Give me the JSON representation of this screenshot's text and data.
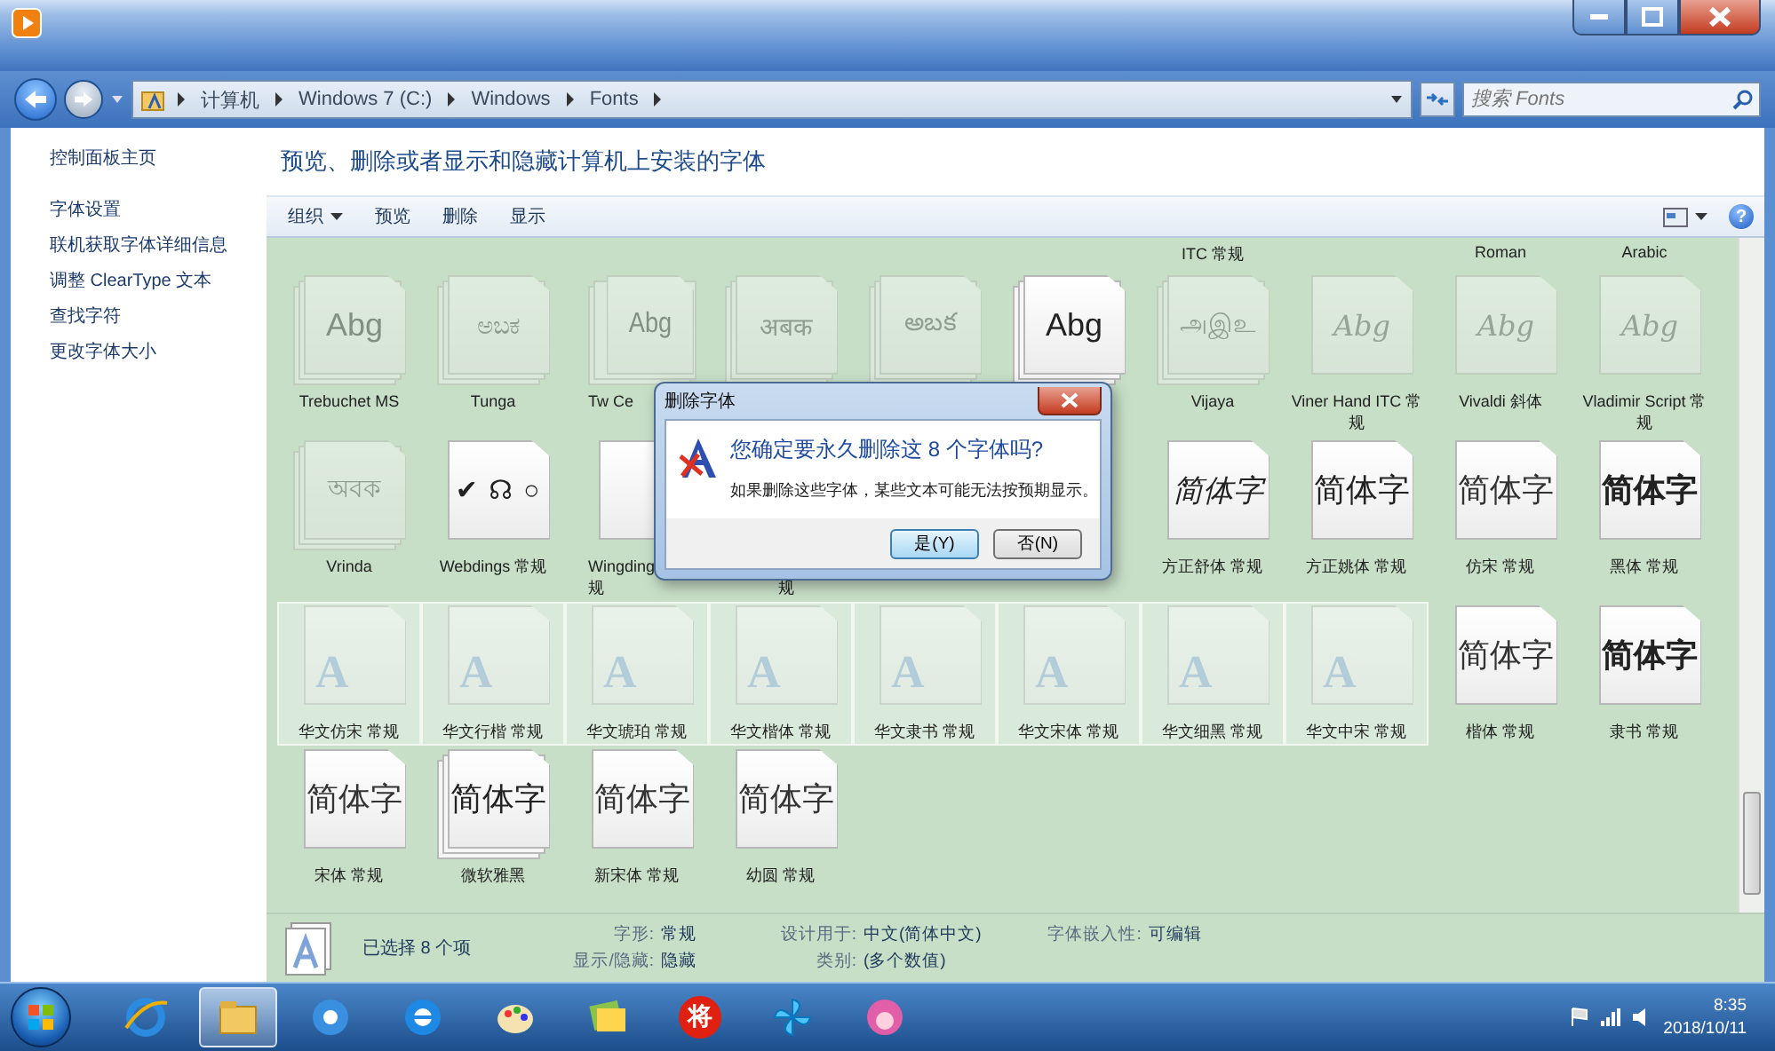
{
  "window": {
    "controls": [
      {
        "kind": "minimize"
      },
      {
        "kind": "maximize"
      },
      {
        "kind": "close"
      }
    ]
  },
  "address_bar": {
    "path": [
      "计算机",
      "Windows 7 (C:)",
      "Windows",
      "Fonts"
    ],
    "search_placeholder": "搜索 Fonts"
  },
  "sidebar": {
    "items": [
      {
        "label": "控制面板主页",
        "kind": "home"
      },
      {
        "label": "字体设置",
        "kind": "link"
      },
      {
        "label": "联机获取字体详细信息",
        "kind": "link"
      },
      {
        "label": "调整 ClearType 文本",
        "kind": "link"
      },
      {
        "label": "查找字符",
        "kind": "link"
      },
      {
        "label": "更改字体大小",
        "kind": "link"
      }
    ]
  },
  "header": {
    "title": "预览、删除或者显示和隐藏计算机上安装的字体"
  },
  "toolbar": {
    "items": [
      {
        "label": "组织",
        "menu": true
      },
      {
        "label": "预览",
        "menu": false
      },
      {
        "label": "删除",
        "menu": false
      },
      {
        "label": "显示",
        "menu": false
      }
    ],
    "help": "?"
  },
  "partial_row": [
    {
      "label": "ITC 常规"
    },
    {
      "label": "Roman"
    },
    {
      "label": "Arabic"
    }
  ],
  "tiles": [
    {
      "label": "Trebuchet MS",
      "preview": "Abg",
      "kind": "latin",
      "hidden": true,
      "stacked": true,
      "selected": false
    },
    {
      "label": "Tunga",
      "preview": "ಅಬಕ",
      "kind": "indic",
      "hidden": true,
      "stacked": true,
      "selected": false
    },
    {
      "label": "Tw Ce",
      "preview": "Abg",
      "kind": "narrow",
      "hidden": true,
      "stacked": true,
      "covered": true
    },
    {
      "preview": "अबक",
      "kind": "indic",
      "hidden": true,
      "stacked": true
    },
    {
      "preview": "అబక",
      "kind": "indic",
      "hidden": true,
      "stacked": true
    },
    {
      "preview": "Abg",
      "kind": "latin",
      "hidden": false,
      "stacked": true
    },
    {
      "label": "Vijaya",
      "preview": "அஇஉ",
      "kind": "indic",
      "hidden": true,
      "stacked": true,
      "selected": false
    },
    {
      "label": "Viner Hand ITC 常规",
      "preview": "Abg",
      "kind": "script",
      "hidden": true,
      "stacked": false,
      "selected": false
    },
    {
      "label": "Vivaldi 斜体",
      "preview": "Abg",
      "kind": "script",
      "hidden": true,
      "stacked": false,
      "selected": false
    },
    {
      "label": "Vladimir Script 常规",
      "preview": "Abg",
      "kind": "script",
      "hidden": true,
      "stacked": false,
      "selected": false
    },
    {
      "label": "Vrinda",
      "preview": "অবক",
      "kind": "indic",
      "hidden": true,
      "stacked": true,
      "selected": false
    },
    {
      "label": "Webdings 常规",
      "preview": "✔ ☊ ○",
      "kind": "symbol",
      "hidden": false,
      "stacked": false,
      "selected": false
    },
    {
      "label": "Wingding\n规",
      "covered": true
    },
    {
      "label": "规",
      "label_cut": true
    },
    {
      "label": "方正舒体 常规",
      "preview": "简体字",
      "kind": "cjk-script",
      "hidden": false,
      "stacked": false,
      "selected": false
    },
    {
      "label": "方正姚体 常规",
      "preview": "简体字",
      "kind": "cjk",
      "hidden": false,
      "stacked": false,
      "selected": false
    },
    {
      "label": "仿宋 常规",
      "preview": "简体字",
      "kind": "cjk-light",
      "hidden": false,
      "stacked": false,
      "selected": false
    },
    {
      "label": "黑体 常规",
      "preview": "简体字",
      "kind": "cjk-bold",
      "hidden": false,
      "stacked": false,
      "selected": false
    },
    {
      "label": "华文仿宋 常规",
      "preview": "A",
      "kind": "file",
      "hidden": true,
      "stacked": false,
      "selected": true
    },
    {
      "label": "华文行楷 常规",
      "preview": "A",
      "kind": "file",
      "hidden": true,
      "stacked": false,
      "selected": true
    },
    {
      "label": "华文琥珀 常规",
      "preview": "A",
      "kind": "file",
      "hidden": true,
      "stacked": false,
      "selected": true
    },
    {
      "label": "华文楷体 常规",
      "preview": "A",
      "kind": "file",
      "hidden": true,
      "stacked": false,
      "selected": true
    },
    {
      "label": "华文隶书 常规",
      "preview": "A",
      "kind": "file",
      "hidden": true,
      "stacked": false,
      "selected": true
    },
    {
      "label": "华文宋体 常规",
      "preview": "A",
      "kind": "file",
      "hidden": true,
      "stacked": false,
      "selected": true
    },
    {
      "label": "华文细黑 常规",
      "preview": "A",
      "kind": "file",
      "hidden": true,
      "stacked": false,
      "selected": true
    },
    {
      "label": "华文中宋 常规",
      "preview": "A",
      "kind": "file",
      "hidden": true,
      "stacked": false,
      "selected": true
    },
    {
      "label": "楷体 常规",
      "preview": "简体字",
      "kind": "cjk-light",
      "hidden": false,
      "stacked": false,
      "selected": false
    },
    {
      "label": "隶书 常规",
      "preview": "简体字",
      "kind": "cjk-bold",
      "hidden": false,
      "stacked": false,
      "selected": false
    },
    {
      "label": "宋体 常规",
      "preview": "简体字",
      "kind": "cjk-light",
      "hidden": false,
      "stacked": false,
      "selected": false
    },
    {
      "label": "微软雅黑",
      "preview": "简体字",
      "kind": "cjk",
      "hidden": false,
      "stacked": true,
      "selected": false
    },
    {
      "label": "新宋体 常规",
      "preview": "简体字",
      "kind": "cjk-light",
      "hidden": false,
      "stacked": false,
      "selected": false
    },
    {
      "label": "幼圆 常规",
      "preview": "简体字",
      "kind": "cjk-light",
      "hidden": false,
      "stacked": false,
      "selected": false
    }
  ],
  "details": {
    "selection": "已选择 8 个项",
    "fields": [
      {
        "label": "字形:",
        "value": "常规"
      },
      {
        "label": "设计用于:",
        "value": "中文(简体中文)"
      },
      {
        "label": "字体嵌入性:",
        "value": "可编辑"
      },
      {
        "label": "显示/隐藏:",
        "value": "隐藏"
      },
      {
        "label": "类别:",
        "value": "(多个数值)"
      }
    ]
  },
  "dialog": {
    "title": "删除字体",
    "question": "您确定要永久删除这 8 个字体吗?",
    "message": "如果删除这些字体，某些文本可能无法按预期显示。",
    "buttons": [
      {
        "label": "是(Y)",
        "selected": true
      },
      {
        "label": "否(N)",
        "selected": false
      }
    ]
  },
  "taskbar": {
    "items": [
      {
        "kind": "ie",
        "selected": false
      },
      {
        "kind": "folder",
        "selected": true
      },
      {
        "kind": "media",
        "selected": false
      },
      {
        "kind": "browser",
        "selected": false
      },
      {
        "kind": "paint",
        "selected": false
      },
      {
        "kind": "files",
        "selected": false
      },
      {
        "kind": "badge",
        "label": "将",
        "selected": false
      },
      {
        "kind": "pinwheel",
        "selected": false
      },
      {
        "kind": "pig",
        "selected": false
      }
    ],
    "time": "8:35",
    "date": "2018/10/11"
  }
}
